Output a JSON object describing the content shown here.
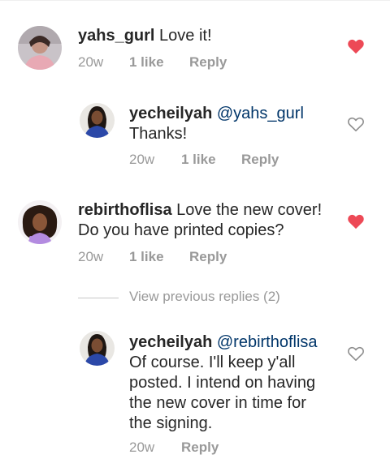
{
  "comments": [
    {
      "username": "yahs_gurl",
      "text": "Love it!",
      "time": "20w",
      "likes": "1 like",
      "reply": "Reply",
      "liked": true
    },
    {
      "username": "yecheilyah",
      "mention": "@yahs_gurl",
      "text": "Thanks!",
      "time": "20w",
      "likes": "1 like",
      "reply": "Reply",
      "liked": false
    },
    {
      "username": "rebirthoflisa",
      "text_line1": "Love the new cover!",
      "text_line2": "Do you have printed copies?",
      "time": "20w",
      "likes": "1 like",
      "reply": "Reply",
      "liked": true
    },
    {
      "username": "yecheilyah",
      "mention": "@rebirthoflisa",
      "lines": [
        "Of course. I'll keep y'all",
        "posted. I intend on having",
        "the new cover in time for",
        "the signing."
      ],
      "time": "20w",
      "reply": "Reply",
      "liked": false
    }
  ],
  "view_previous": "View previous replies (2)",
  "colors": {
    "heart_liked": "#ed4956",
    "heart_empty": "#8e8e8e",
    "mention": "#003569",
    "meta": "#999999"
  }
}
